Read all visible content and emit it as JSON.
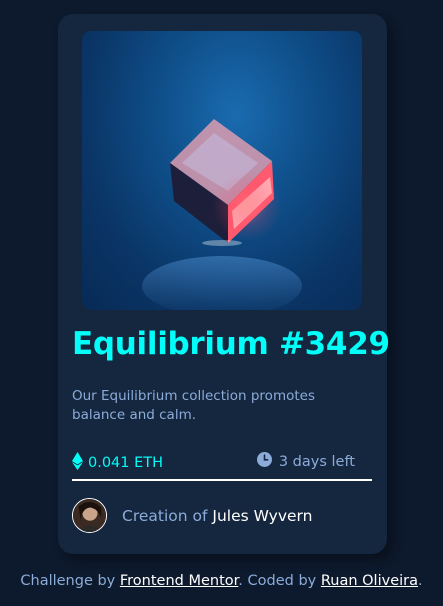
{
  "card": {
    "title": "Equilibrium #3429",
    "description": "Our Equilibrium collection promotes balance and calm.",
    "price": "0.041 ETH",
    "time_left": "3 days left",
    "creator_prefix": "Creation of ",
    "creator_name": "Jules Wyvern"
  },
  "footer": {
    "challenge_prefix": "Challenge by ",
    "challenge_link": "Frontend Mentor",
    "coded_prefix": ". Coded by ",
    "author_link": "Ruan Oliveira",
    "suffix": "."
  },
  "icons": {
    "price": "ethereum-icon",
    "time": "clock-icon"
  },
  "colors": {
    "background": "#0d192c",
    "card": "#15263f",
    "accent_cyan": "#00fff8",
    "soft_blue": "#8bacd9",
    "white": "#ffffff"
  }
}
